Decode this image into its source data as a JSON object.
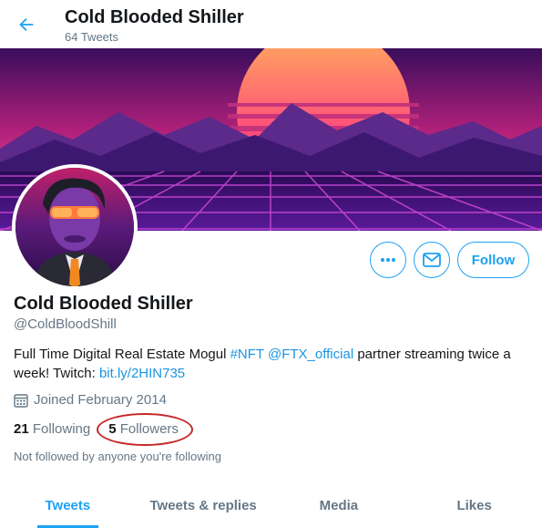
{
  "header": {
    "title": "Cold Blooded Shiller",
    "subtitle": "64 Tweets"
  },
  "profile": {
    "display_name": "Cold Blooded Shiller",
    "handle": "@ColdBloodShill",
    "bio_text_1": "Full Time Digital Real Estate Mogul ",
    "bio_hashtag": "#NFT",
    "bio_mention": "@FTX_official",
    "bio_text_2": " partner streaming twice a week! Twitch: ",
    "bio_link": "bit.ly/2HIN735",
    "joined": "Joined February 2014",
    "following_count": "21",
    "following_label": "Following",
    "followers_count": "5",
    "followers_label": "Followers",
    "not_followed": "Not followed by anyone you're following"
  },
  "actions": {
    "more_icon": "more-dots-icon",
    "message_icon": "mail-icon",
    "follow_label": "Follow"
  },
  "tabs": [
    {
      "label": "Tweets"
    },
    {
      "label": "Tweets & replies"
    },
    {
      "label": "Media"
    },
    {
      "label": "Likes"
    }
  ],
  "colors": {
    "accent": "#1da1f2",
    "annotation": "#c62828"
  }
}
